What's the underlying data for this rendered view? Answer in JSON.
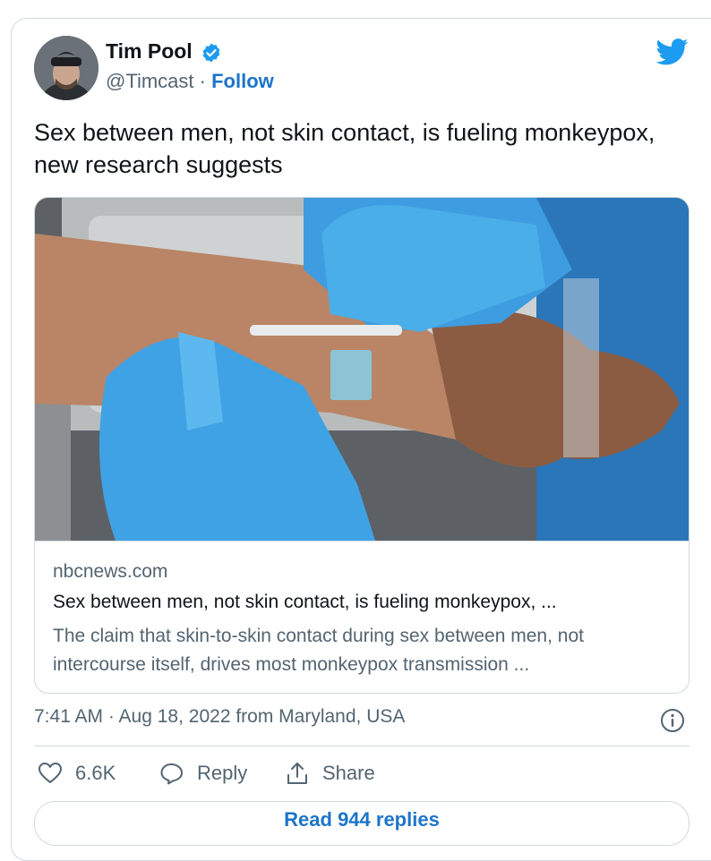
{
  "author": {
    "name": "Tim Pool",
    "handle": "@Timcast",
    "separator": "·",
    "follow_label": "Follow"
  },
  "tweet": {
    "text": "Sex between men, not skin contact, is fueling monkeypox, new research suggests"
  },
  "link_card": {
    "domain": "nbcnews.com",
    "title": "Sex between men, not skin contact, is fueling monkeypox, ...",
    "description": "The claim that skin-to-skin contact during sex between men, not intercourse itself, drives most monkeypox transmission ..."
  },
  "meta": {
    "timestamp": "7:41 AM · Aug 18, 2022 from Maryland, USA"
  },
  "actions": {
    "like_count": "6.6K",
    "reply_label": "Reply",
    "share_label": "Share"
  },
  "footer": {
    "read_replies_label": "Read 944 replies"
  },
  "icons": {
    "verified": "verified-badge-icon",
    "bird": "twitter-bird-icon",
    "heart": "heart-icon",
    "reply": "reply-bubble-icon",
    "share": "share-icon",
    "info": "info-icon"
  },
  "colors": {
    "brand_blue": "#1d9bf0",
    "link_blue": "#1d74c9",
    "muted": "#536471",
    "text": "#0f1419",
    "border": "#cfd9de"
  }
}
